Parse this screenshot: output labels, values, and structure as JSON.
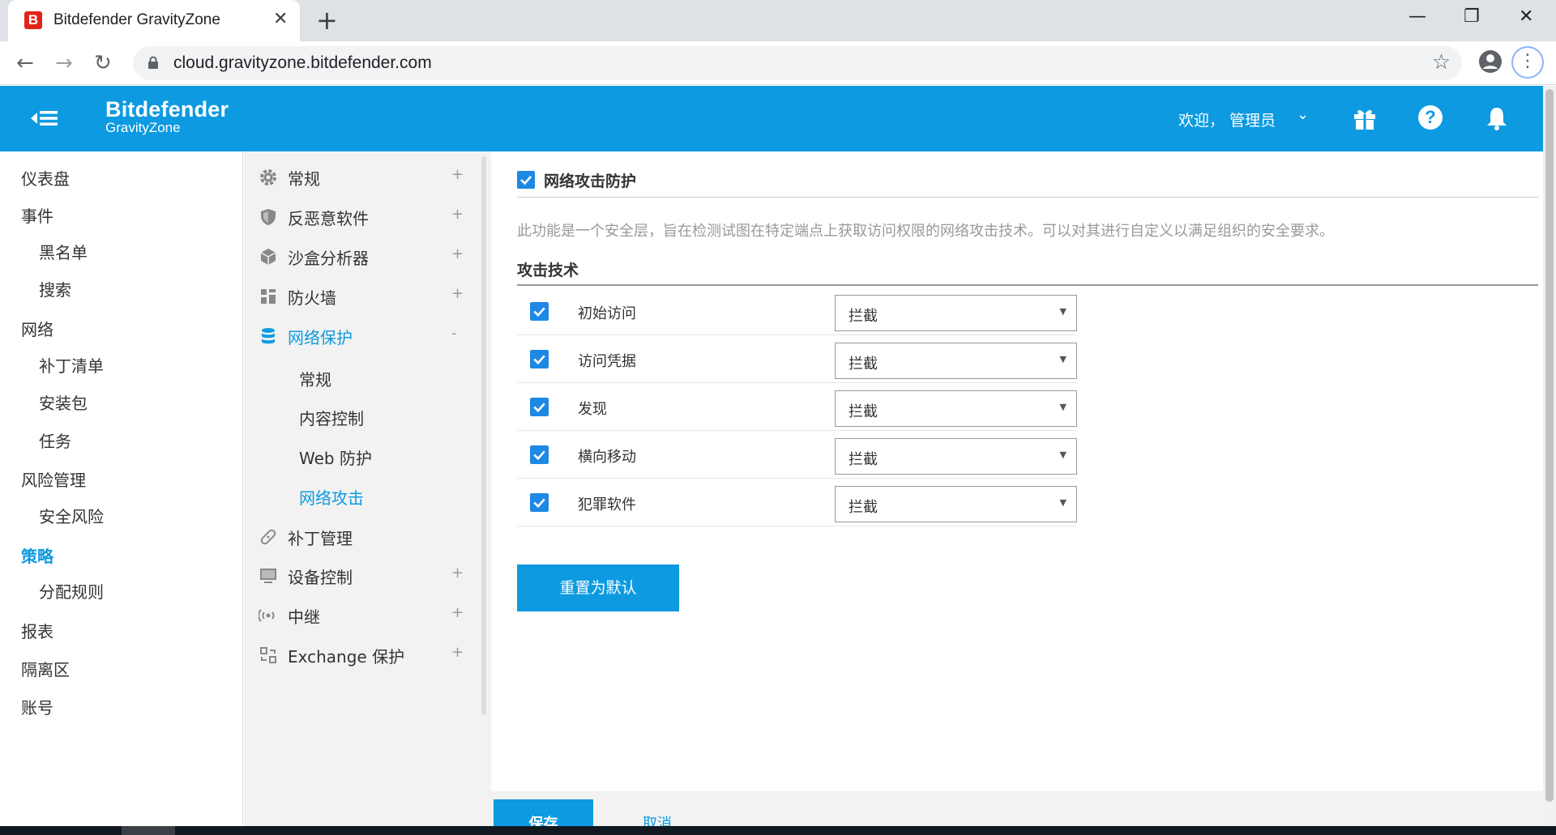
{
  "browser": {
    "tab_title": "Bitdefender GravityZone",
    "favicon_letter": "B",
    "close_glyph": "✕",
    "new_tab_glyph": "+",
    "url": "cloud.gravityzone.bitdefender.com",
    "minimize_glyph": "—",
    "restore_glyph": "❐",
    "window_close_glyph": "✕",
    "back_glyph": "←",
    "forward_glyph": "→",
    "reload_glyph": "↻",
    "star_glyph": "☆",
    "menu_glyph": "⋮"
  },
  "header": {
    "brand_name": "Bitdefender",
    "brand_sub": "GravityZone",
    "welcome": "欢迎，  管理员",
    "caret": "⌄",
    "help_glyph": "?"
  },
  "left_nav": {
    "dashboard": "仪表盘",
    "events": "事件",
    "blacklist": "黑名单",
    "search": "搜索",
    "network": "网络",
    "patch_inventory": "补丁清单",
    "packages": "安装包",
    "tasks": "任务",
    "risk_management": "风险管理",
    "security_risks": "安全风险",
    "policies": "策略",
    "assignment_rules": "分配规则",
    "reports": "报表",
    "quarantine": "隔离区",
    "accounts": "账号"
  },
  "policy_nav": {
    "general": "常规",
    "antimalware": "反恶意软件",
    "sandbox": "沙盒分析器",
    "firewall": "防火墙",
    "network_protection": "网络保护",
    "np_general": "常规",
    "content_control": "内容控制",
    "web_protection": "Web 防护",
    "network_attack": "网络攻击",
    "patch_management": "补丁管理",
    "device_control": "设备控制",
    "relay": "中继",
    "exchange": "Exchange 保护",
    "plus": "+",
    "minus": "-"
  },
  "main": {
    "header_title": "网络攻击防护",
    "description": "此功能是一个安全层，旨在检测试图在特定端点上获取访问权限的网络攻击技术。可以对其进行自定义以满足组织的安全要求。",
    "section_title": "攻击技术",
    "techniques": [
      {
        "label": "初始访问",
        "action": "拦截"
      },
      {
        "label": "访问凭据",
        "action": "拦截"
      },
      {
        "label": "发现",
        "action": "拦截"
      },
      {
        "label": "横向移动",
        "action": "拦截"
      },
      {
        "label": "犯罪软件",
        "action": "拦截"
      }
    ],
    "caret": "▼",
    "reset_button": "重置为默认"
  },
  "footer": {
    "save": "保存",
    "cancel": "取消"
  },
  "colors": {
    "brand_blue": "#0d9ae1",
    "checkbox_blue": "#1e88e5"
  }
}
